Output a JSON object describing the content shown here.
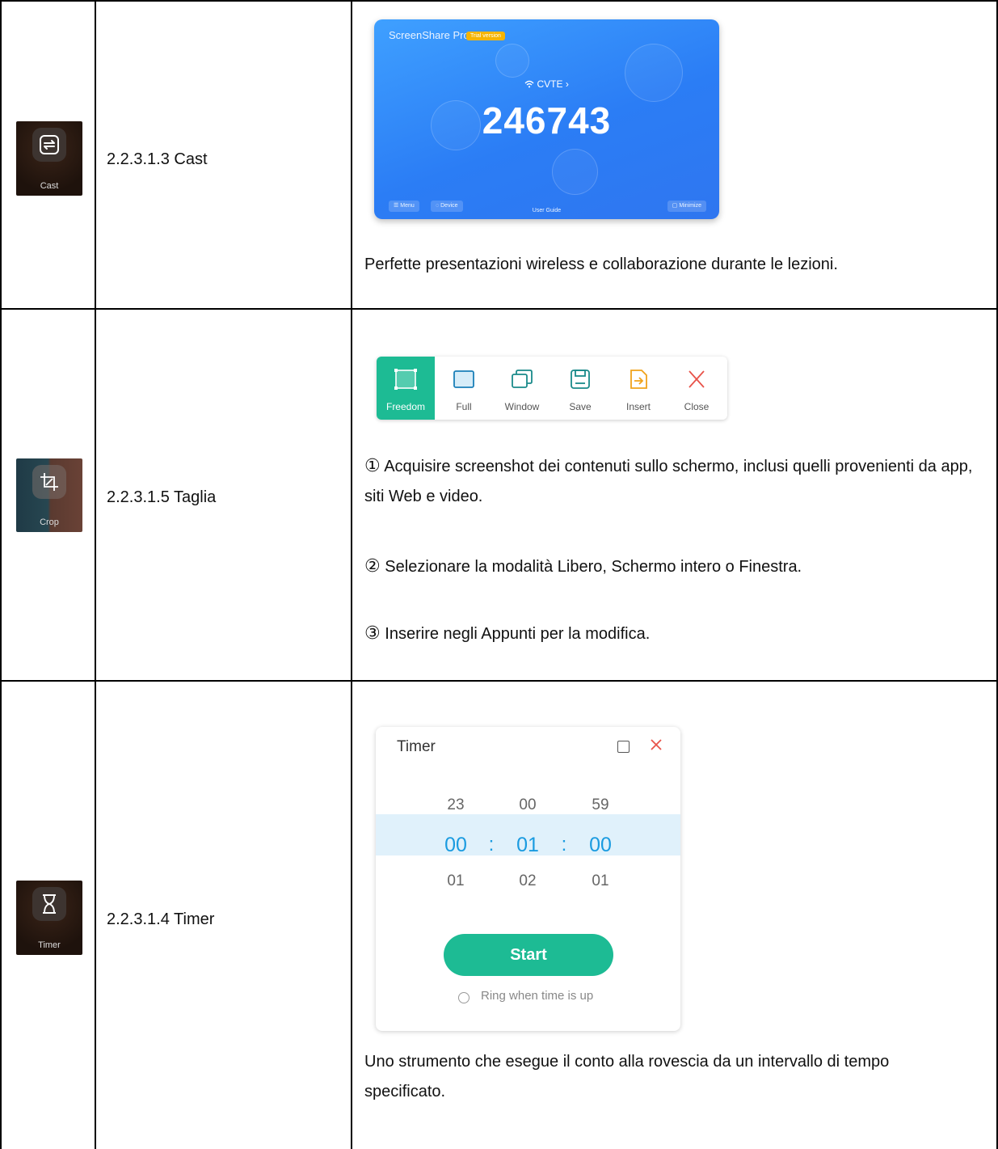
{
  "rows": [
    {
      "title": "2.2.3.1.3 Cast",
      "icon_label": "Cast",
      "icon": "cast-icon",
      "description": "Perfette presentazioni wireless e collaborazione durante le lezioni.",
      "screenshot": {
        "app_name": "ScreenShare Pro",
        "badge": "Trial version",
        "network": "CVTE",
        "code": "246743",
        "menu": "Menu",
        "device": "Device",
        "user_guide": "User Guide",
        "minimize": "Minimize"
      }
    },
    {
      "title": "2.2.3.1.5 Taglia",
      "icon_label": "Crop",
      "icon": "crop-icon",
      "toolbar": [
        "Freedom",
        "Full",
        "Window",
        "Save",
        "Insert",
        "Close"
      ],
      "steps": [
        {
          "num": "①",
          "text": "Acquisire screenshot dei contenuti sullo schermo, inclusi quelli provenienti da app, siti Web e video."
        },
        {
          "num": "②",
          "text": "Selezionare la modalità Libero, Schermo intero o Finestra."
        },
        {
          "num": "③",
          "text": "Inserire negli Appunti per la modifica."
        }
      ]
    },
    {
      "title": "2.2.3.1.4 Timer",
      "icon_label": "Timer",
      "icon": "hourglass-icon",
      "description": "Uno strumento che esegue il conto alla rovescia da un intervallo di tempo specificato.",
      "dialog": {
        "title": "Timer",
        "above": [
          "23",
          "00",
          "59"
        ],
        "selected": [
          "00",
          "01",
          "00"
        ],
        "below": [
          "01",
          "02",
          "01"
        ],
        "separator": ":",
        "start": "Start",
        "ring": "Ring when time is up"
      }
    }
  ],
  "colors": {
    "accent_green": "#1dbb94",
    "timer_blue": "#1a9be0",
    "cast_blue": "#2b7df5",
    "close_red": "#e8534a",
    "insert_orange": "#f0a21b"
  }
}
